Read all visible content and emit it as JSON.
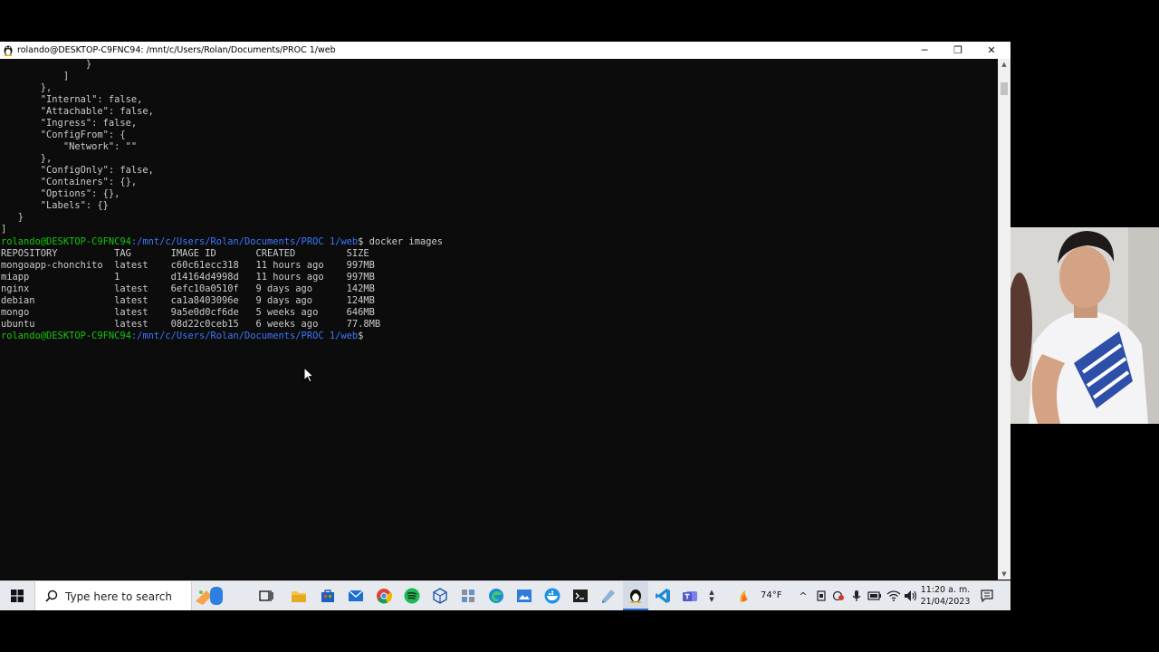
{
  "window": {
    "title": "rolando@DESKTOP-C9FNC94: /mnt/c/Users/Rolan/Documents/PROC 1/web",
    "minimize_glyph": "─",
    "maximize_glyph": "❐",
    "close_glyph": "✕"
  },
  "terminal": {
    "json_lines": [
      "               }",
      "           ]",
      "       },",
      "       \"Internal\": false,",
      "       \"Attachable\": false,",
      "       \"Ingress\": false,",
      "       \"ConfigFrom\": {",
      "           \"Network\": \"\"",
      "       },",
      "       \"ConfigOnly\": false,",
      "       \"Containers\": {},",
      "       \"Options\": {},",
      "       \"Labels\": {}",
      "   }",
      "]"
    ],
    "prompt_user": "rolando@DESKTOP-C9FNC94",
    "prompt_path": ":/mnt/c/Users/Rolan/Documents/PROC 1/web",
    "prompt_symbol": "$",
    "command": " docker images",
    "table_header": "REPOSITORY          TAG       IMAGE ID       CREATED         SIZE",
    "table_rows": [
      "mongoapp-chonchito  latest    c60c61ecc318   11 hours ago    997MB",
      "miapp               1         d14164d4998d   11 hours ago    997MB",
      "nginx               latest    6efc10a0510f   9 days ago      142MB",
      "debian              latest    ca1a8403096e   9 days ago      124MB",
      "mongo               latest    9a5e0d0cf6de   5 weeks ago     646MB",
      "ubuntu              latest    08d22c0ceb15   6 weeks ago     77.8MB"
    ]
  },
  "taskbar": {
    "search_placeholder": "Type here to search",
    "weather": "74°F",
    "time": "11:20 a. m.",
    "date": "21/04/2023"
  },
  "colors": {
    "prompt_user": "#16c60c",
    "prompt_path": "#3b78ff",
    "terminal_bg": "#0c0c0c",
    "terminal_fg": "#cccccc"
  }
}
